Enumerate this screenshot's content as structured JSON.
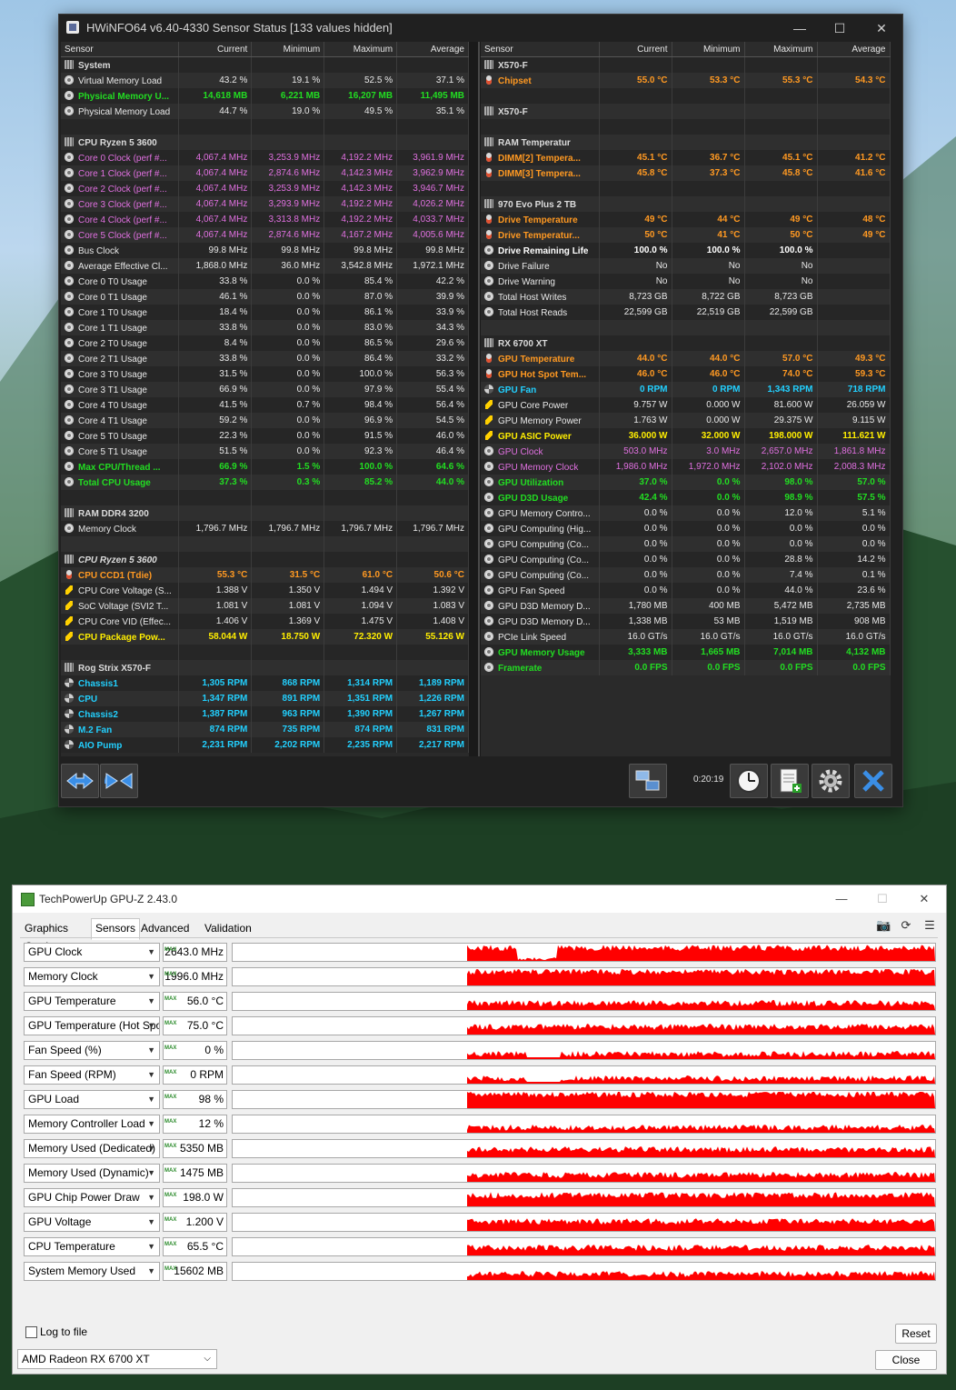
{
  "hwinfo": {
    "title": "HWiNFO64 v6.40-4330 Sensor Status [133 values hidden]",
    "timer": "0:20:19",
    "columns": [
      "Sensor",
      "Current",
      "Minimum",
      "Maximum",
      "Average"
    ],
    "left_rows": [
      {
        "t": "group",
        "name": "System"
      },
      {
        "t": "row",
        "name": "Virtual Memory Load",
        "cur": "43.2 %",
        "min": "19.1 %",
        "max": "52.5 %",
        "avg": "37.1 %",
        "icon": "circle",
        "color": "white"
      },
      {
        "t": "row",
        "name": "Physical Memory U...",
        "cur": "14,618 MB",
        "min": "6,221 MB",
        "max": "16,207 MB",
        "avg": "11,495 MB",
        "icon": "circle",
        "color": "green"
      },
      {
        "t": "row",
        "name": "Physical Memory Load",
        "cur": "44.7 %",
        "min": "19.0 %",
        "max": "49.5 %",
        "avg": "35.1 %",
        "icon": "circle",
        "color": "white"
      },
      {
        "t": "blank"
      },
      {
        "t": "group",
        "name": "CPU Ryzen 5 3600"
      },
      {
        "t": "row",
        "name": "Core 0 Clock (perf #...",
        "cur": "4,067.4 MHz",
        "min": "3,253.9 MHz",
        "max": "4,192.2 MHz",
        "avg": "3,961.9 MHz",
        "icon": "circle",
        "color": "mag"
      },
      {
        "t": "row",
        "name": "Core 1 Clock (perf #...",
        "cur": "4,067.4 MHz",
        "min": "2,874.6 MHz",
        "max": "4,142.3 MHz",
        "avg": "3,962.9 MHz",
        "icon": "circle",
        "color": "mag"
      },
      {
        "t": "row",
        "name": "Core 2 Clock (perf #...",
        "cur": "4,067.4 MHz",
        "min": "3,253.9 MHz",
        "max": "4,142.3 MHz",
        "avg": "3,946.7 MHz",
        "icon": "circle",
        "color": "mag"
      },
      {
        "t": "row",
        "name": "Core 3 Clock (perf #...",
        "cur": "4,067.4 MHz",
        "min": "3,293.9 MHz",
        "max": "4,192.2 MHz",
        "avg": "4,026.2 MHz",
        "icon": "circle",
        "color": "mag"
      },
      {
        "t": "row",
        "name": "Core 4 Clock (perf #...",
        "cur": "4,067.4 MHz",
        "min": "3,313.8 MHz",
        "max": "4,192.2 MHz",
        "avg": "4,033.7 MHz",
        "icon": "circle",
        "color": "mag"
      },
      {
        "t": "row",
        "name": "Core 5 Clock (perf #...",
        "cur": "4,067.4 MHz",
        "min": "2,874.6 MHz",
        "max": "4,167.2 MHz",
        "avg": "4,005.6 MHz",
        "icon": "circle",
        "color": "mag"
      },
      {
        "t": "row",
        "name": "Bus Clock",
        "cur": "99.8 MHz",
        "min": "99.8 MHz",
        "max": "99.8 MHz",
        "avg": "99.8 MHz",
        "icon": "circle",
        "color": "white"
      },
      {
        "t": "row",
        "name": "Average Effective Cl...",
        "cur": "1,868.0 MHz",
        "min": "36.0 MHz",
        "max": "3,542.8 MHz",
        "avg": "1,972.1 MHz",
        "icon": "circle",
        "color": "white"
      },
      {
        "t": "row",
        "name": "Core 0 T0 Usage",
        "cur": "33.8 %",
        "min": "0.0 %",
        "max": "85.4 %",
        "avg": "42.2 %",
        "icon": "circle",
        "color": "white"
      },
      {
        "t": "row",
        "name": "Core 0 T1 Usage",
        "cur": "46.1 %",
        "min": "0.0 %",
        "max": "87.0 %",
        "avg": "39.9 %",
        "icon": "circle",
        "color": "white"
      },
      {
        "t": "row",
        "name": "Core 1 T0 Usage",
        "cur": "18.4 %",
        "min": "0.0 %",
        "max": "86.1 %",
        "avg": "33.9 %",
        "icon": "circle",
        "color": "white"
      },
      {
        "t": "row",
        "name": "Core 1 T1 Usage",
        "cur": "33.8 %",
        "min": "0.0 %",
        "max": "83.0 %",
        "avg": "34.3 %",
        "icon": "circle",
        "color": "white"
      },
      {
        "t": "row",
        "name": "Core 2 T0 Usage",
        "cur": "8.4 %",
        "min": "0.0 %",
        "max": "86.5 %",
        "avg": "29.6 %",
        "icon": "circle",
        "color": "white"
      },
      {
        "t": "row",
        "name": "Core 2 T1 Usage",
        "cur": "33.8 %",
        "min": "0.0 %",
        "max": "86.4 %",
        "avg": "33.2 %",
        "icon": "circle",
        "color": "white"
      },
      {
        "t": "row",
        "name": "Core 3 T0 Usage",
        "cur": "31.5 %",
        "min": "0.0 %",
        "max": "100.0 %",
        "avg": "56.3 %",
        "icon": "circle",
        "color": "white"
      },
      {
        "t": "row",
        "name": "Core 3 T1 Usage",
        "cur": "66.9 %",
        "min": "0.0 %",
        "max": "97.9 %",
        "avg": "55.4 %",
        "icon": "circle",
        "color": "white"
      },
      {
        "t": "row",
        "name": "Core 4 T0 Usage",
        "cur": "41.5 %",
        "min": "0.7 %",
        "max": "98.4 %",
        "avg": "56.4 %",
        "icon": "circle",
        "color": "white"
      },
      {
        "t": "row",
        "name": "Core 4 T1 Usage",
        "cur": "59.2 %",
        "min": "0.0 %",
        "max": "96.9 %",
        "avg": "54.5 %",
        "icon": "circle",
        "color": "white"
      },
      {
        "t": "row",
        "name": "Core 5 T0 Usage",
        "cur": "22.3 %",
        "min": "0.0 %",
        "max": "91.5 %",
        "avg": "46.0 %",
        "icon": "circle",
        "color": "white"
      },
      {
        "t": "row",
        "name": "Core 5 T1 Usage",
        "cur": "51.5 %",
        "min": "0.0 %",
        "max": "92.3 %",
        "avg": "46.4 %",
        "icon": "circle",
        "color": "white"
      },
      {
        "t": "row",
        "name": "Max CPU/Thread ...",
        "cur": "66.9 %",
        "min": "1.5 %",
        "max": "100.0 %",
        "avg": "64.6 %",
        "icon": "circle",
        "color": "green"
      },
      {
        "t": "row",
        "name": "Total CPU Usage",
        "cur": "37.3 %",
        "min": "0.3 %",
        "max": "85.2 %",
        "avg": "44.0 %",
        "icon": "circle",
        "color": "green"
      },
      {
        "t": "blank"
      },
      {
        "t": "group",
        "name": "RAM DDR4 3200"
      },
      {
        "t": "row",
        "name": "Memory Clock",
        "cur": "1,796.7 MHz",
        "min": "1,796.7 MHz",
        "max": "1,796.7 MHz",
        "avg": "1,796.7 MHz",
        "icon": "circle",
        "color": "white"
      },
      {
        "t": "blank"
      },
      {
        "t": "group",
        "name": "CPU Ryzen 5 3600",
        "ital": true
      },
      {
        "t": "row",
        "name": "CPU CCD1 (Tdie)",
        "cur": "55.3 °C",
        "min": "31.5 °C",
        "max": "61.0 °C",
        "avg": "50.6 °C",
        "icon": "therm",
        "color": "orange"
      },
      {
        "t": "row",
        "name": "CPU Core Voltage (S...",
        "cur": "1.388 V",
        "min": "1.350 V",
        "max": "1.494 V",
        "avg": "1.392 V",
        "icon": "bolt",
        "color": "white"
      },
      {
        "t": "row",
        "name": "SoC Voltage (SVI2 T...",
        "cur": "1.081 V",
        "min": "1.081 V",
        "max": "1.094 V",
        "avg": "1.083 V",
        "icon": "bolt",
        "color": "white"
      },
      {
        "t": "row",
        "name": "CPU Core VID (Effec...",
        "cur": "1.406 V",
        "min": "1.369 V",
        "max": "1.475 V",
        "avg": "1.408 V",
        "icon": "bolt",
        "color": "white"
      },
      {
        "t": "row",
        "name": "CPU Package Pow...",
        "cur": "58.044 W",
        "min": "18.750 W",
        "max": "72.320 W",
        "avg": "55.126 W",
        "icon": "bolt",
        "color": "yellow"
      },
      {
        "t": "blank"
      },
      {
        "t": "group",
        "name": "Rog Strix X570-F"
      },
      {
        "t": "row",
        "name": "Chassis1",
        "cur": "1,305 RPM",
        "min": "868 RPM",
        "max": "1,314 RPM",
        "avg": "1,189 RPM",
        "icon": "fan",
        "color": "cyan"
      },
      {
        "t": "row",
        "name": "CPU",
        "cur": "1,347 RPM",
        "min": "891 RPM",
        "max": "1,351 RPM",
        "avg": "1,226 RPM",
        "icon": "fan",
        "color": "cyan"
      },
      {
        "t": "row",
        "name": "Chassis2",
        "cur": "1,387 RPM",
        "min": "963 RPM",
        "max": "1,390 RPM",
        "avg": "1,267 RPM",
        "icon": "fan",
        "color": "cyan"
      },
      {
        "t": "row",
        "name": "M.2 Fan",
        "cur": "874 RPM",
        "min": "735 RPM",
        "max": "874 RPM",
        "avg": "831 RPM",
        "icon": "fan",
        "color": "cyan"
      },
      {
        "t": "row",
        "name": "AIO Pump",
        "cur": "2,231 RPM",
        "min": "2,202 RPM",
        "max": "2,235 RPM",
        "avg": "2,217 RPM",
        "icon": "fan",
        "color": "cyan"
      }
    ],
    "right_rows": [
      {
        "t": "group",
        "name": "X570-F"
      },
      {
        "t": "row",
        "name": "Chipset",
        "cur": "55.0 °C",
        "min": "53.3 °C",
        "max": "55.3 °C",
        "avg": "54.3 °C",
        "icon": "therm",
        "color": "orange"
      },
      {
        "t": "blank"
      },
      {
        "t": "group",
        "name": "X570-F"
      },
      {
        "t": "blank"
      },
      {
        "t": "group",
        "name": "RAM Temperatur"
      },
      {
        "t": "row",
        "name": "DIMM[2] Tempera...",
        "cur": "45.1 °C",
        "min": "36.7 °C",
        "max": "45.1 °C",
        "avg": "41.2 °C",
        "icon": "therm",
        "color": "orange"
      },
      {
        "t": "row",
        "name": "DIMM[3] Tempera...",
        "cur": "45.8 °C",
        "min": "37.3 °C",
        "max": "45.8 °C",
        "avg": "41.6 °C",
        "icon": "therm",
        "color": "orange"
      },
      {
        "t": "blank"
      },
      {
        "t": "group",
        "name": "970 Evo Plus 2 TB"
      },
      {
        "t": "row",
        "name": "Drive Temperature",
        "cur": "49 °C",
        "min": "44 °C",
        "max": "49 °C",
        "avg": "48 °C",
        "icon": "therm",
        "color": "orange"
      },
      {
        "t": "row",
        "name": "Drive Temperatur...",
        "cur": "50 °C",
        "min": "41 °C",
        "max": "50 °C",
        "avg": "49 °C",
        "icon": "therm",
        "color": "orange"
      },
      {
        "t": "row",
        "name": "Drive Remaining Life",
        "cur": "100.0 %",
        "min": "100.0 %",
        "max": "100.0 %",
        "avg": "",
        "icon": "circle",
        "color": "wb"
      },
      {
        "t": "row",
        "name": "Drive Failure",
        "cur": "No",
        "min": "No",
        "max": "No",
        "avg": "",
        "icon": "circle",
        "color": "white"
      },
      {
        "t": "row",
        "name": "Drive Warning",
        "cur": "No",
        "min": "No",
        "max": "No",
        "avg": "",
        "icon": "circle",
        "color": "white"
      },
      {
        "t": "row",
        "name": "Total Host Writes",
        "cur": "8,723 GB",
        "min": "8,722 GB",
        "max": "8,723 GB",
        "avg": "",
        "icon": "circle",
        "color": "white"
      },
      {
        "t": "row",
        "name": "Total Host Reads",
        "cur": "22,599 GB",
        "min": "22,519 GB",
        "max": "22,599 GB",
        "avg": "",
        "icon": "circle",
        "color": "white"
      },
      {
        "t": "blank"
      },
      {
        "t": "group",
        "name": "RX 6700 XT"
      },
      {
        "t": "row",
        "name": "GPU Temperature",
        "cur": "44.0 °C",
        "min": "44.0 °C",
        "max": "57.0 °C",
        "avg": "49.3 °C",
        "icon": "therm",
        "color": "orange"
      },
      {
        "t": "row",
        "name": "GPU Hot Spot Tem...",
        "cur": "46.0 °C",
        "min": "46.0 °C",
        "max": "74.0 °C",
        "avg": "59.3 °C",
        "icon": "therm",
        "color": "orange"
      },
      {
        "t": "row",
        "name": "GPU Fan",
        "cur": "0 RPM",
        "min": "0 RPM",
        "max": "1,343 RPM",
        "avg": "718 RPM",
        "icon": "fan",
        "color": "cyan"
      },
      {
        "t": "row",
        "name": "GPU Core Power",
        "cur": "9.757 W",
        "min": "0.000 W",
        "max": "81.600 W",
        "avg": "26.059 W",
        "icon": "bolt",
        "color": "white"
      },
      {
        "t": "row",
        "name": "GPU Memory Power",
        "cur": "1.763 W",
        "min": "0.000 W",
        "max": "29.375 W",
        "avg": "9.115 W",
        "icon": "bolt",
        "color": "white"
      },
      {
        "t": "row",
        "name": "GPU ASIC Power",
        "cur": "36.000 W",
        "min": "32.000 W",
        "max": "198.000 W",
        "avg": "111.621 W",
        "icon": "bolt",
        "color": "yellow"
      },
      {
        "t": "row",
        "name": "GPU Clock",
        "cur": "503.0 MHz",
        "min": "3.0 MHz",
        "max": "2,657.0 MHz",
        "avg": "1,861.8 MHz",
        "icon": "circle",
        "color": "mag"
      },
      {
        "t": "row",
        "name": "GPU Memory Clock",
        "cur": "1,986.0 MHz",
        "min": "1,972.0 MHz",
        "max": "2,102.0 MHz",
        "avg": "2,008.3 MHz",
        "icon": "circle",
        "color": "mag"
      },
      {
        "t": "row",
        "name": "GPU Utilization",
        "cur": "37.0 %",
        "min": "0.0 %",
        "max": "98.0 %",
        "avg": "57.0 %",
        "icon": "circle",
        "color": "green"
      },
      {
        "t": "row",
        "name": "GPU D3D Usage",
        "cur": "42.4 %",
        "min": "0.0 %",
        "max": "98.9 %",
        "avg": "57.5 %",
        "icon": "circle",
        "color": "green"
      },
      {
        "t": "row",
        "name": "GPU Memory Contro...",
        "cur": "0.0 %",
        "min": "0.0 %",
        "max": "12.0 %",
        "avg": "5.1 %",
        "icon": "circle",
        "color": "white"
      },
      {
        "t": "row",
        "name": "GPU Computing (Hig...",
        "cur": "0.0 %",
        "min": "0.0 %",
        "max": "0.0 %",
        "avg": "0.0 %",
        "icon": "circle",
        "color": "white"
      },
      {
        "t": "row",
        "name": "GPU Computing (Co...",
        "cur": "0.0 %",
        "min": "0.0 %",
        "max": "0.0 %",
        "avg": "0.0 %",
        "icon": "circle",
        "color": "white"
      },
      {
        "t": "row",
        "name": "GPU Computing (Co...",
        "cur": "0.0 %",
        "min": "0.0 %",
        "max": "28.8 %",
        "avg": "14.2 %",
        "icon": "circle",
        "color": "white"
      },
      {
        "t": "row",
        "name": "GPU Computing (Co...",
        "cur": "0.0 %",
        "min": "0.0 %",
        "max": "7.4 %",
        "avg": "0.1 %",
        "icon": "circle",
        "color": "white"
      },
      {
        "t": "row",
        "name": "GPU Fan Speed",
        "cur": "0.0 %",
        "min": "0.0 %",
        "max": "44.0 %",
        "avg": "23.6 %",
        "icon": "circle",
        "color": "white"
      },
      {
        "t": "row",
        "name": "GPU D3D Memory D...",
        "cur": "1,780 MB",
        "min": "400 MB",
        "max": "5,472 MB",
        "avg": "2,735 MB",
        "icon": "circle",
        "color": "white"
      },
      {
        "t": "row",
        "name": "GPU D3D Memory D...",
        "cur": "1,338 MB",
        "min": "53 MB",
        "max": "1,519 MB",
        "avg": "908 MB",
        "icon": "circle",
        "color": "white"
      },
      {
        "t": "row",
        "name": "PCIe Link Speed",
        "cur": "16.0 GT/s",
        "min": "16.0 GT/s",
        "max": "16.0 GT/s",
        "avg": "16.0 GT/s",
        "icon": "circle",
        "color": "white"
      },
      {
        "t": "row",
        "name": "GPU Memory Usage",
        "cur": "3,333 MB",
        "min": "1,665 MB",
        "max": "7,014 MB",
        "avg": "4,132 MB",
        "icon": "circle",
        "color": "green"
      },
      {
        "t": "row",
        "name": "Framerate",
        "cur": "0.0 FPS",
        "min": "0.0 FPS",
        "max": "0.0 FPS",
        "avg": "0.0 FPS",
        "icon": "circle",
        "color": "green"
      }
    ]
  },
  "gpuz": {
    "title": "TechPowerUp GPU-Z 2.43.0",
    "tabs": [
      "Graphics Card",
      "Sensors",
      "Advanced",
      "Validation"
    ],
    "max_badge": "MAX",
    "sensors": [
      {
        "name": "GPU Clock",
        "value": "2643.0 MHz"
      },
      {
        "name": "Memory Clock",
        "value": "1996.0 MHz"
      },
      {
        "name": "GPU Temperature",
        "value": "56.0 °C"
      },
      {
        "name": "GPU Temperature (Hot Spot)",
        "value": "75.0 °C"
      },
      {
        "name": "Fan Speed (%)",
        "value": "0 %"
      },
      {
        "name": "Fan Speed (RPM)",
        "value": "0 RPM"
      },
      {
        "name": "GPU Load",
        "value": "98 %"
      },
      {
        "name": "Memory Controller Load",
        "value": "12 %"
      },
      {
        "name": "Memory Used (Dedicated)",
        "value": "5350 MB"
      },
      {
        "name": "Memory Used (Dynamic)",
        "value": "1475 MB"
      },
      {
        "name": "GPU Chip Power Draw",
        "value": "198.0 W"
      },
      {
        "name": "GPU Voltage",
        "value": "1.200 V"
      },
      {
        "name": "CPU Temperature",
        "value": "65.5 °C"
      },
      {
        "name": "System Memory Used",
        "value": "15602 MB"
      }
    ],
    "log_label": "Log to file",
    "reset_label": "Reset",
    "close_label": "Close",
    "device": "AMD Radeon RX 6700 XT",
    "graph_color": "#ff0000"
  }
}
